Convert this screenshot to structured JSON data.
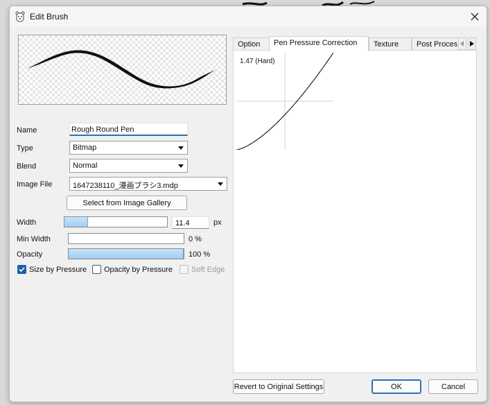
{
  "window": {
    "title": "Edit Brush",
    "app_icon": "bear-app-icon",
    "close_icon": "close-icon"
  },
  "form": {
    "name_label": "Name",
    "name_value": "Rough Round Pen",
    "type_label": "Type",
    "type_value": "Bitmap",
    "blend_label": "Blend",
    "blend_value": "Normal",
    "image_file_label": "Image File",
    "image_file_value": "1647238110_漫画ブラシ3.mdp",
    "gallery_button": "Select from Image Gallery",
    "width_label": "Width",
    "width_value": "11.4",
    "width_unit": "px",
    "width_fraction": 0.23,
    "min_width_label": "Min Width",
    "min_width_value": "0 %",
    "min_width_fraction": 0.0,
    "opacity_label": "Opacity",
    "opacity_value": "100 %",
    "opacity_fraction": 1.0,
    "size_by_pressure_label": "Size by Pressure",
    "size_by_pressure_checked": true,
    "opacity_by_pressure_label": "Opacity by Pressure",
    "opacity_by_pressure_checked": false,
    "soft_edge_label": "Soft Edge",
    "soft_edge_checked": false,
    "soft_edge_disabled": true
  },
  "tabs": [
    {
      "label": "Option",
      "active": false
    },
    {
      "label": "Pen Pressure Correction",
      "active": true
    },
    {
      "label": "Texture",
      "active": false
    },
    {
      "label": "Post Proces",
      "active": false
    }
  ],
  "pressure": {
    "label": "1.47 (Hard)",
    "gamma": 1.47
  },
  "buttons": {
    "revert": "Revert to Original Settings",
    "ok": "OK",
    "cancel": "Cancel"
  },
  "colors": {
    "accent": "#1f5fa8",
    "slider_fill": "#9fcdf2",
    "dialog_bg": "#f0f0f0"
  }
}
